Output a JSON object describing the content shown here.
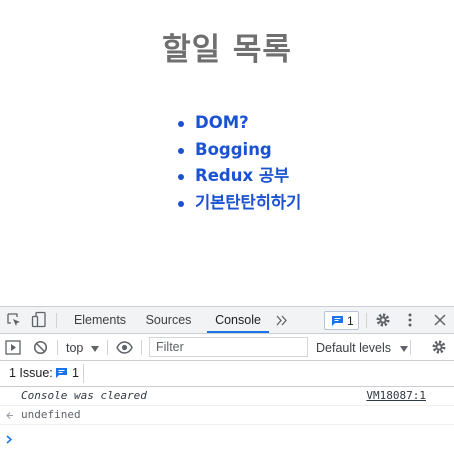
{
  "page": {
    "title": "할일 목록",
    "todos": [
      "DOM?",
      "Bogging",
      "Redux 공부",
      "기본탄탄히하기"
    ]
  },
  "devtools": {
    "tabs": [
      "Elements",
      "Sources",
      "Console"
    ],
    "active_tab": "Console",
    "more_tabs_icon": "double-chevron-right-icon",
    "issues_count": "1",
    "toolbar": {
      "context": "top",
      "filter_placeholder": "Filter",
      "levels": "Default levels"
    },
    "issues_bar": {
      "label": "1 Issue:",
      "count": "1"
    },
    "messages": [
      {
        "text": "Console was cleared",
        "source": "VM18087:1"
      },
      {
        "text": "undefined"
      }
    ]
  },
  "colors": {
    "todo_text": "#1a52d1",
    "title_text": "#6f6f6f",
    "accent": "#1a73e8",
    "devtools_bg": "#f1f3f4"
  }
}
